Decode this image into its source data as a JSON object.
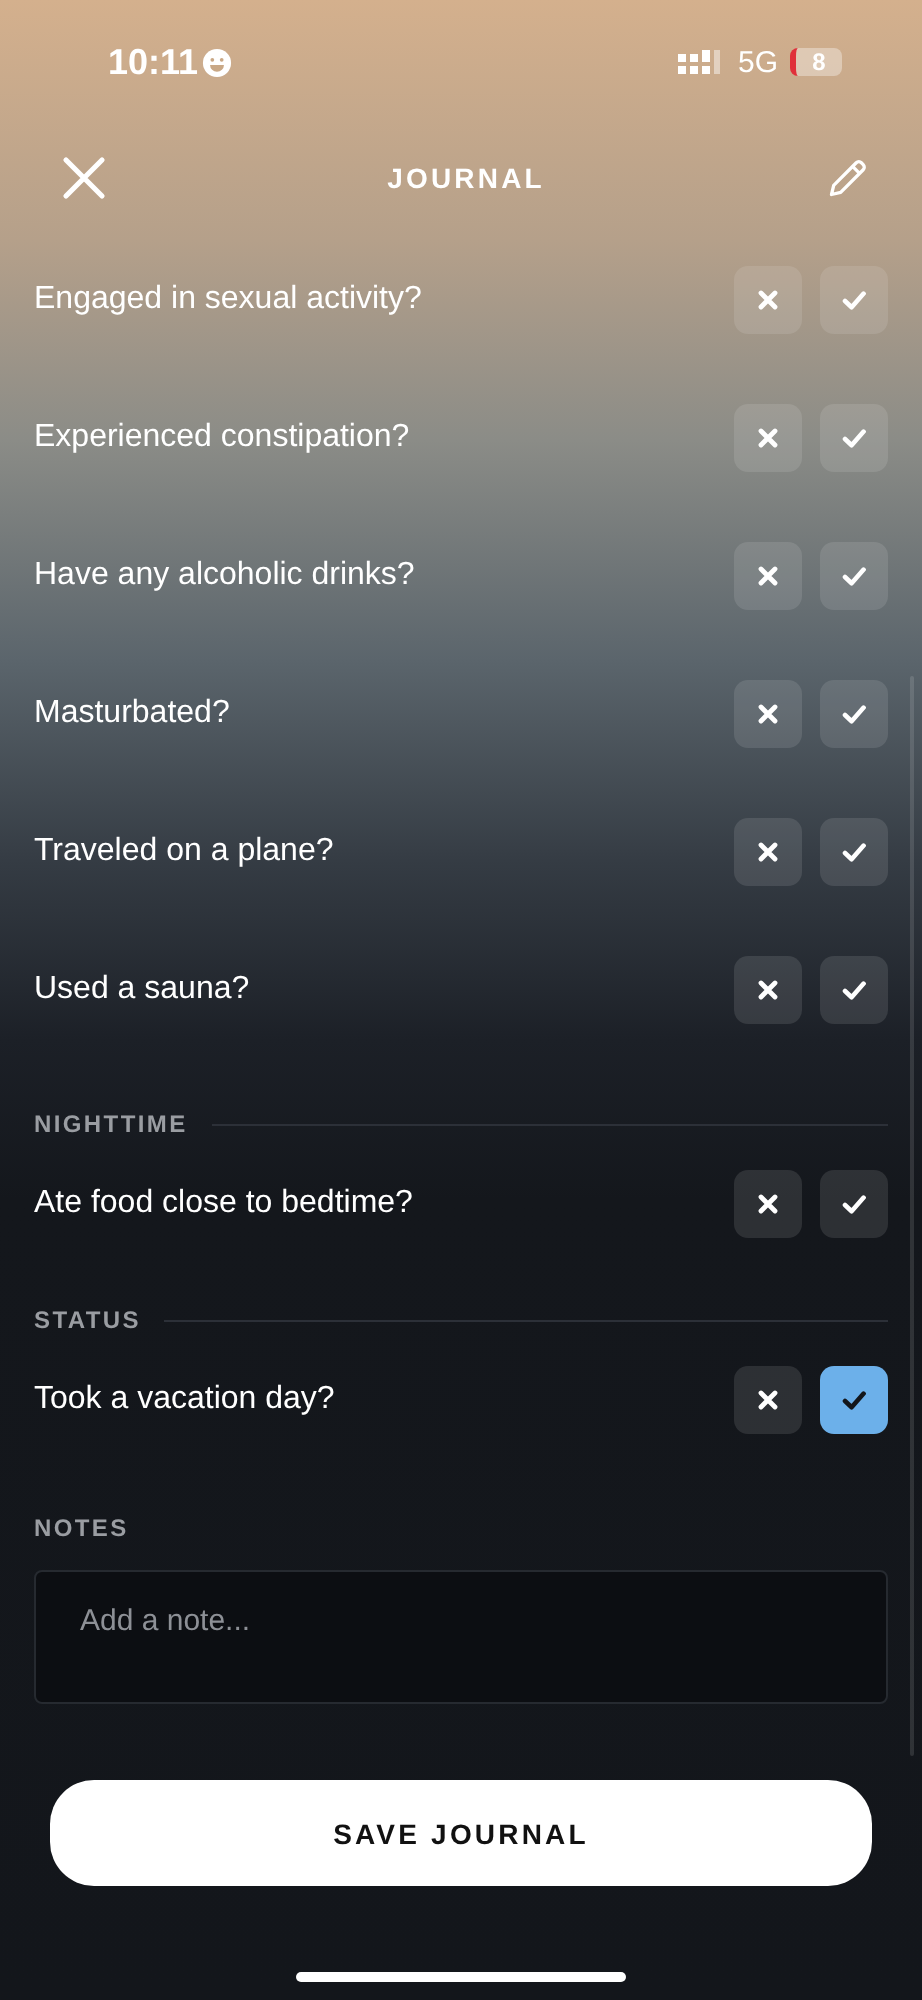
{
  "status_bar": {
    "time": "10:11",
    "network": "5G",
    "battery": "8"
  },
  "header": {
    "title": "JOURNAL"
  },
  "sections": [
    {
      "items": [
        {
          "label": "Engaged in sexual activity?",
          "buttons": [
            {
              "kind": "no",
              "selected": false
            },
            {
              "kind": "yes",
              "selected": false
            }
          ]
        },
        {
          "label": "Experienced constipation?",
          "buttons": [
            {
              "kind": "no",
              "selected": false
            },
            {
              "kind": "yes",
              "selected": false
            }
          ]
        },
        {
          "label": "Have any alcoholic drinks?",
          "buttons": [
            {
              "kind": "no",
              "selected": false
            },
            {
              "kind": "yes",
              "selected": false
            }
          ]
        },
        {
          "label": "Masturbated?",
          "buttons": [
            {
              "kind": "no",
              "selected": false
            },
            {
              "kind": "yes",
              "selected": false
            }
          ]
        },
        {
          "label": "Traveled on a plane?",
          "buttons": [
            {
              "kind": "no",
              "selected": false
            },
            {
              "kind": "yes",
              "selected": false
            }
          ]
        },
        {
          "label": "Used a sauna?",
          "buttons": [
            {
              "kind": "no",
              "selected": false
            },
            {
              "kind": "yes",
              "selected": false
            }
          ]
        }
      ]
    },
    {
      "title": "NIGHTTIME",
      "items": [
        {
          "label": "Ate food close to bedtime?",
          "buttons": [
            {
              "kind": "no",
              "selected": false
            },
            {
              "kind": "yes",
              "selected": false
            }
          ]
        }
      ]
    },
    {
      "title": "STATUS",
      "items": [
        {
          "label": "Took a vacation day?",
          "buttons": [
            {
              "kind": "no",
              "selected": false
            },
            {
              "kind": "yes",
              "selected": true
            }
          ]
        }
      ]
    }
  ],
  "notes": {
    "title": "NOTES",
    "placeholder": "Add a note..."
  },
  "save_button": "SAVE JOURNAL"
}
